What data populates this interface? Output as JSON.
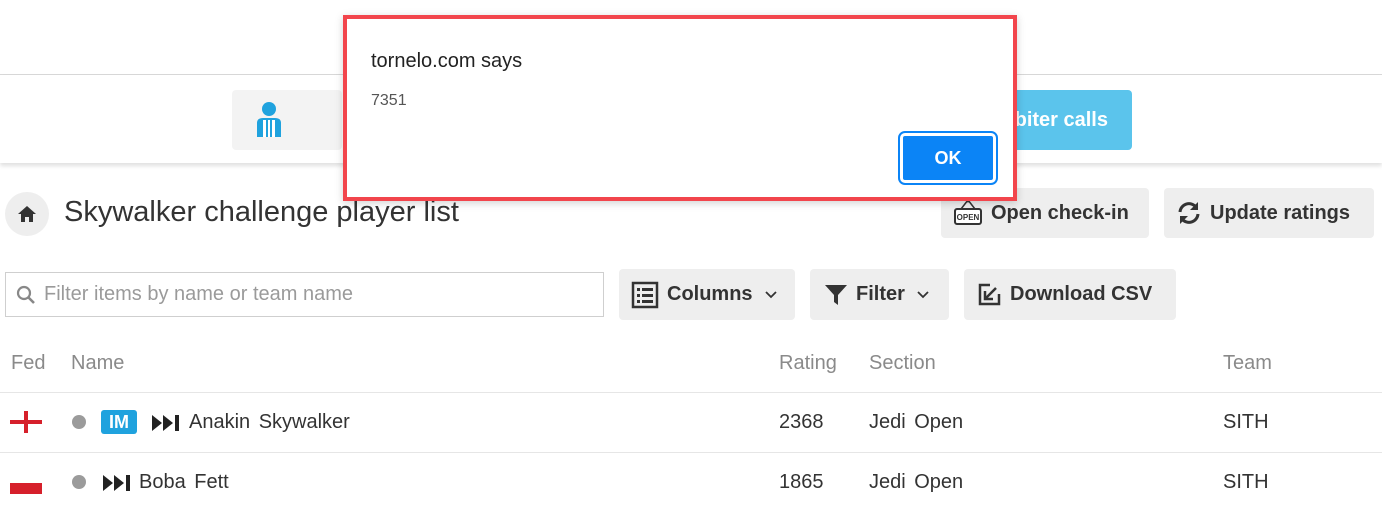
{
  "toolbar": {
    "arbiter_calls_label": "biter calls"
  },
  "page": {
    "title": "Skywalker challenge player list",
    "open_checkin_label": "Open check-in",
    "update_ratings_label": "Update ratings",
    "open_sign_text": "OPEN"
  },
  "search": {
    "placeholder": "Filter items by name or team name",
    "value": ""
  },
  "actions": {
    "columns_label": "Columns",
    "filter_label": "Filter",
    "download_csv_label": "Download CSV"
  },
  "table": {
    "headers": [
      "Fed",
      "Name",
      "Rating",
      "Section",
      "Team"
    ],
    "rows": [
      {
        "fed": "England",
        "title": "IM",
        "name": "Anakin Skywalker",
        "rating": "2368",
        "section": "Jedi Open",
        "team": "SITH",
        "status_color": "#9b9b9b"
      },
      {
        "fed": "Poland",
        "title": "",
        "name": "Boba Fett",
        "rating": "1865",
        "section": "Jedi Open",
        "team": "SITH",
        "status_color": "#9b9b9b"
      }
    ]
  },
  "dialog": {
    "title": "tornelo.com says",
    "message": "7351",
    "ok_label": "OK"
  },
  "colors": {
    "accent": "#5bc4ec",
    "im_badge": "#1fa2de",
    "dialog_border": "#f2454c",
    "ok_button": "#0b84f6"
  },
  "icons": [
    "arbiter-icon",
    "home-icon",
    "open-sign-icon",
    "refresh-icon",
    "search-icon",
    "columns-icon",
    "filter-icon",
    "download-icon",
    "chevron-down-icon",
    "skip-forward-icon"
  ]
}
